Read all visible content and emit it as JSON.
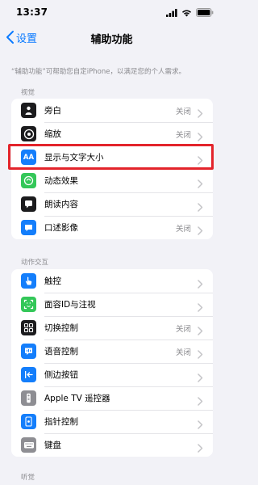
{
  "status": {
    "time": "13:37"
  },
  "nav": {
    "back_label": "设置",
    "title": "辅助功能"
  },
  "intro": "“辅助功能”可帮助您自定iPhone，以满足您的个人需求。",
  "sections": [
    {
      "header": "视觉",
      "items": [
        {
          "label": "旁白",
          "value": "关闭",
          "icon": "voiceover-icon",
          "color": "#1c1c1e"
        },
        {
          "label": "缩放",
          "value": "关闭",
          "icon": "zoom-icon",
          "color": "#1c1c1e"
        },
        {
          "label": "显示与文字大小",
          "value": "",
          "icon": "text-size-icon",
          "icon_text": "AA",
          "color": "#147efb"
        },
        {
          "label": "动态效果",
          "value": "",
          "icon": "motion-icon",
          "color": "#34c759"
        },
        {
          "label": "朗读内容",
          "value": "",
          "icon": "spoken-content-icon",
          "color": "#1c1c1e"
        },
        {
          "label": "口述影像",
          "value": "关闭",
          "icon": "audio-description-icon",
          "color": "#147efb"
        }
      ]
    },
    {
      "header": "动作交互",
      "items": [
        {
          "label": "触控",
          "value": "",
          "icon": "touch-icon",
          "color": "#147efb"
        },
        {
          "label": "面容ID与注视",
          "value": "",
          "icon": "face-id-icon",
          "color": "#34c759"
        },
        {
          "label": "切换控制",
          "value": "关闭",
          "icon": "switch-control-icon",
          "color": "#1c1c1e"
        },
        {
          "label": "语音控制",
          "value": "关闭",
          "icon": "voice-control-icon",
          "color": "#147efb"
        },
        {
          "label": "侧边按钮",
          "value": "",
          "icon": "side-button-icon",
          "color": "#147efb"
        },
        {
          "label": "Apple TV 遥控器",
          "value": "",
          "icon": "remote-icon",
          "color": "#8e8e93"
        },
        {
          "label": "指针控制",
          "value": "",
          "icon": "pointer-control-icon",
          "color": "#147efb"
        },
        {
          "label": "键盘",
          "value": "",
          "icon": "keyboard-icon",
          "color": "#8e8e93"
        }
      ]
    },
    {
      "header": "听觉",
      "items": []
    }
  ],
  "colors": {
    "accent": "#0a7aff",
    "highlight": "#e3242b",
    "background": "#f2f2f7"
  }
}
